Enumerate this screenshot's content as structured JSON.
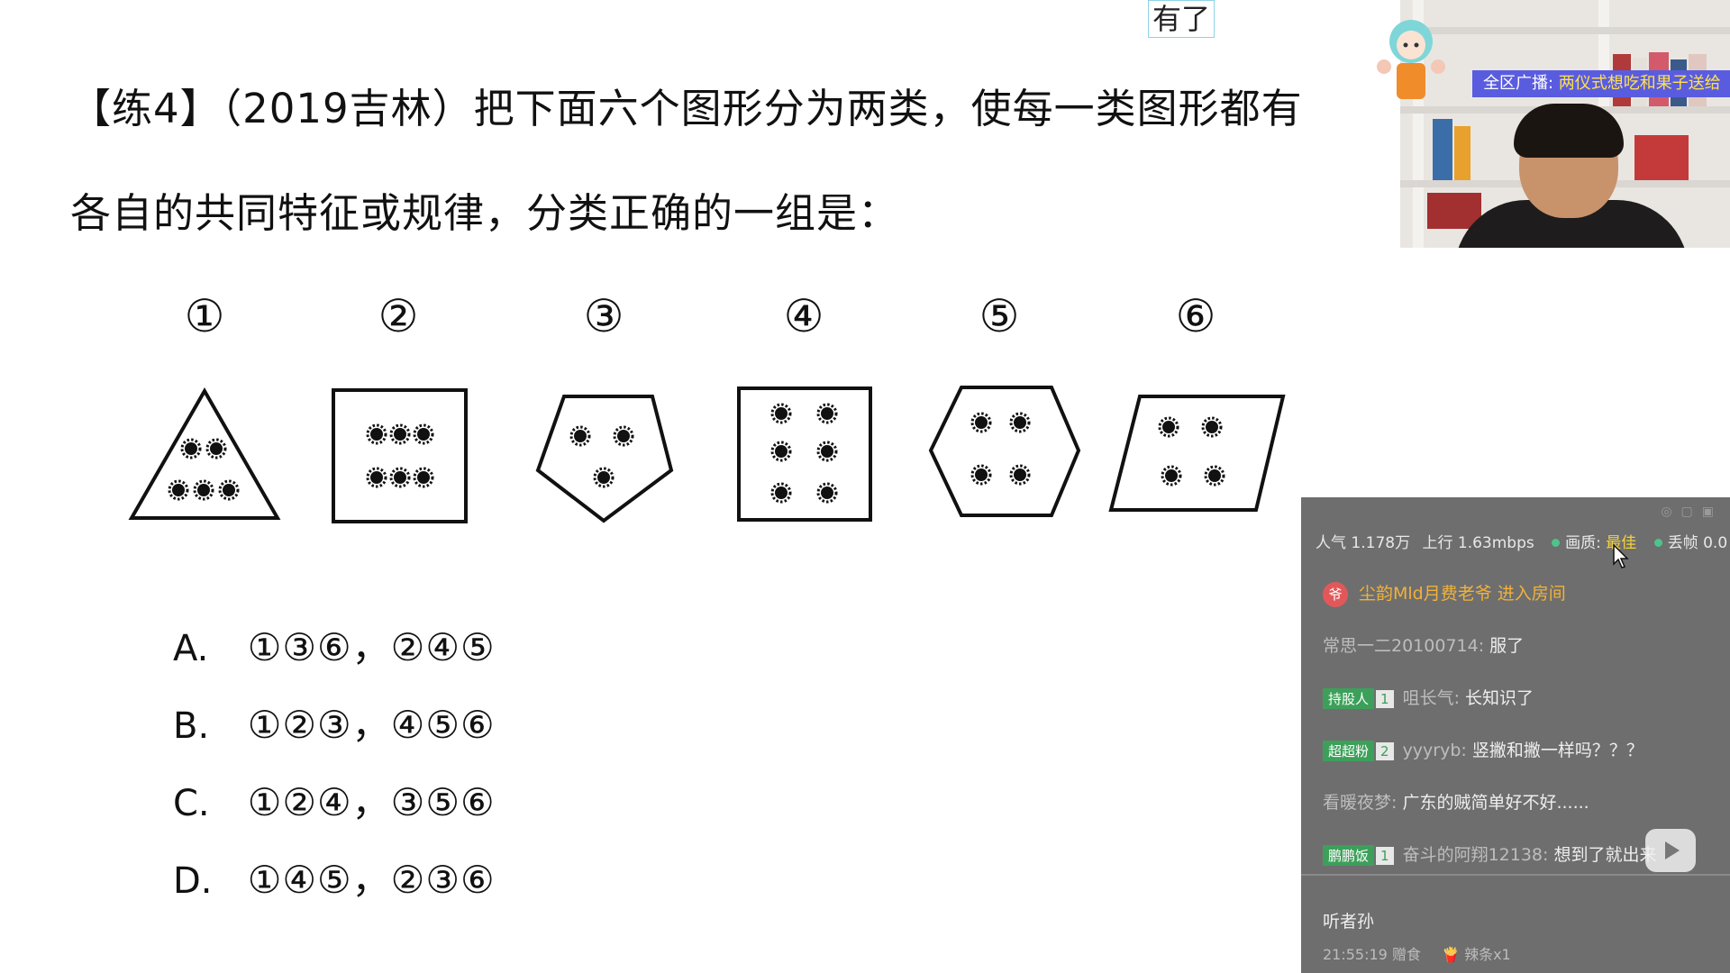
{
  "question": {
    "line1": "【练4】（2019吉林）把下面六个图形分为两类，使每一类图形都有",
    "line2": "各自的共同特征或规律，分类正确的一组是："
  },
  "figure_labels": [
    "①",
    "②",
    "③",
    "④",
    "⑤",
    "⑥"
  ],
  "options": [
    {
      "letter": "A.",
      "text": "①③⑥，②④⑤"
    },
    {
      "letter": "B.",
      "text": "①②③，④⑤⑥"
    },
    {
      "letter": "C.",
      "text": "①②④，③⑤⑥"
    },
    {
      "letter": "D.",
      "text": "①④⑤，②③⑥"
    }
  ],
  "caption": "有了",
  "broadcast": {
    "prefix": "全区广播: ",
    "text": "两仪式想吃和果子送给"
  },
  "stream_stats": {
    "popularity": "人气 1.178万",
    "upload": "上行 1.63mbps",
    "quality_label": "画质: ",
    "quality_value": "最佳",
    "frame_drop": "丢帧 0.0"
  },
  "chat": {
    "messages": [
      {
        "type": "enter",
        "avatar": "爷",
        "text": "尘韵Mld月费老爷 进入房间"
      },
      {
        "user": "常思一二20100714:",
        "text": " 服了"
      },
      {
        "badge": "持股人",
        "level": "1",
        "user": "咀长气:",
        "text": " 长知识了"
      },
      {
        "badge": "超超粉",
        "level": "2",
        "user": "yyyryb:",
        "text": " 竖撇和撇一样吗？？？"
      },
      {
        "user": "看暖夜梦:",
        "text": " 广东的贼简单好不好......"
      },
      {
        "badge": "鹏鹏饭",
        "level": "1",
        "user": "奋斗的阿翔12138:",
        "text": " 想到了就出来"
      }
    ],
    "footer_name": "听者孙",
    "footer_time": "21:55:19 赠食",
    "footer_gift": "辣条x1"
  }
}
